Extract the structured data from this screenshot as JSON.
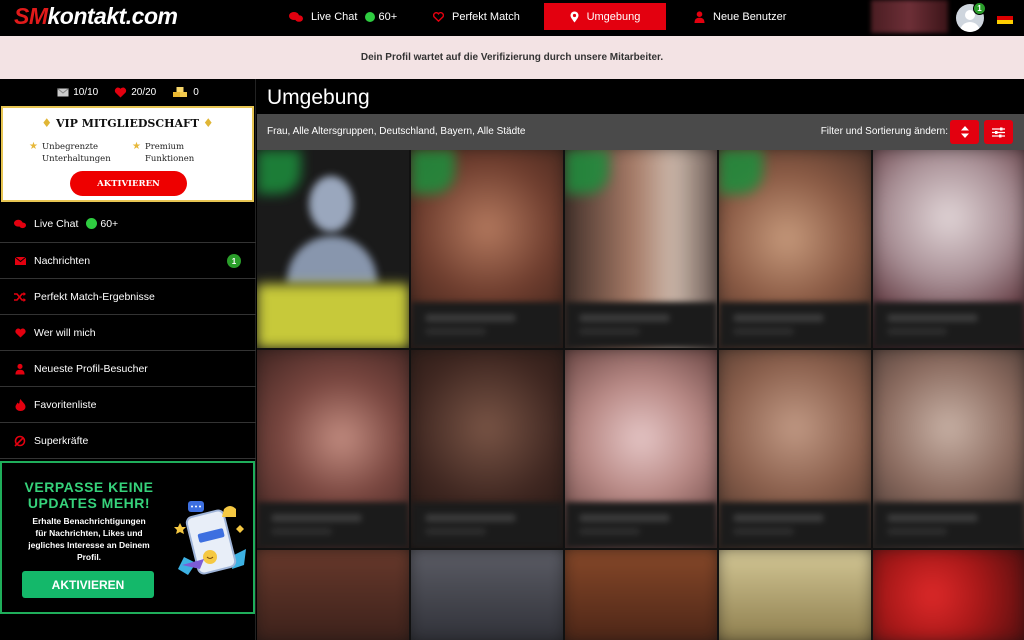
{
  "header": {
    "logo_sm": "SM",
    "logo_rest": "kontakt.com",
    "nav": [
      {
        "label": "Live Chat",
        "count": "60+",
        "icon": "chat-bubbles-icon"
      },
      {
        "label": "Perfekt Match",
        "icon": "heart-outline-icon"
      },
      {
        "label": "Umgebung",
        "icon": "map-pin-icon",
        "active": true
      },
      {
        "label": "Neue Benutzer",
        "icon": "user-icon"
      }
    ],
    "avatar_badge": "1",
    "flag": "german-flag-icon"
  },
  "notice": "Dein Profil wartet auf die Verifizierung durch unsere Mitarbeiter.",
  "sidebar": {
    "stats": {
      "messages": "10/10",
      "likes": "20/20",
      "coins": "0"
    },
    "vip": {
      "title": "VIP MITGLIEDSCHAFT",
      "feature1": "Unbegrenzte Unterhaltungen",
      "feature1_l1": "Unbegrenzte",
      "feature1_l2": "Unterhaltungen",
      "feature2_l1": "Premium",
      "feature2_l2": "Funktionen",
      "button": "AKTIVIEREN"
    },
    "menu": [
      {
        "label": "Live Chat",
        "count": "60+",
        "icon": "chat-bubbles-icon"
      },
      {
        "label": "Nachrichten",
        "badge": "1",
        "icon": "envelope-icon"
      },
      {
        "label": "Perfekt Match-Ergebnisse",
        "icon": "shuffle-icon"
      },
      {
        "label": "Wer will mich",
        "icon": "heart-icon"
      },
      {
        "label": "Neueste Profil-Besucher",
        "icon": "user-icon"
      },
      {
        "label": "Favoritenliste",
        "icon": "fire-icon"
      },
      {
        "label": "Superkräfte",
        "icon": "superpower-icon"
      }
    ],
    "promo": {
      "title_l1": "VERPASSE KEINE",
      "title_l2": "UPDATES MEHR!",
      "text_l1": "Erhalte Benachrichtigungen",
      "text_l2": "für Nachrichten, Likes und",
      "text_l3": "jegliches Interesse an Deinem",
      "text_l4": "Profil.",
      "button": "AKTIVIEREN"
    }
  },
  "main": {
    "title": "Umgebung",
    "filter_summary": "Frau, Alle Altersgruppen, Deutschland, Bayern, Alle Städte",
    "filter_label": "Filter und Sortierung ändern:"
  },
  "colors": {
    "accent": "#e3000f",
    "vip_gold": "#e7c552",
    "promo_green": "#1fae5b",
    "online_green": "#2ecc40"
  }
}
